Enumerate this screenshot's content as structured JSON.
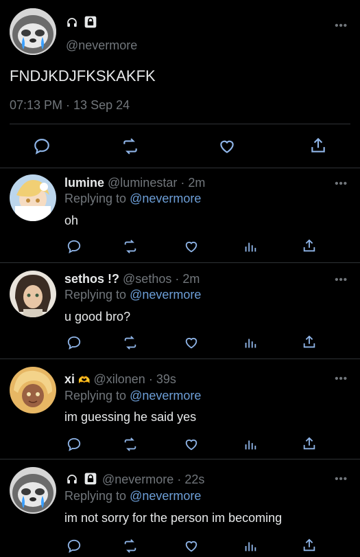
{
  "main_tweet": {
    "handle": "@nevermore",
    "text": "FNDJKDJFKSKAKFK",
    "timestamp": "07:13 PM · 13 Sep 24",
    "more_label": "•••",
    "icons": [
      "headphones-icon",
      "lock-icon"
    ]
  },
  "replies": [
    {
      "name": "lumine",
      "handle": "@luminestar",
      "time": "· 2m",
      "replying_prefix": "Replying to",
      "replying_to": "@nevermore",
      "text": "oh",
      "more_label": "•••"
    },
    {
      "name": "sethos !?",
      "handle": "@sethos",
      "time": "· 2m",
      "replying_prefix": "Replying to",
      "replying_to": "@nevermore",
      "text": "u good bro?",
      "more_label": "•••"
    },
    {
      "name": "xi",
      "name_emoji": "🫶",
      "handle": "@xilonen",
      "time": "· 39s",
      "replying_prefix": "Replying to",
      "replying_to": "@nevermore",
      "text": "im guessing he said yes",
      "more_label": "•••"
    },
    {
      "name": "",
      "handle": "@nevermore",
      "time": "· 22s",
      "replying_prefix": "Replying to",
      "replying_to": "@nevermore",
      "text": "im not sorry for the person im becoming",
      "more_label": "•••"
    }
  ],
  "colors": {
    "background": "#000000",
    "text": "#e7e9ea",
    "muted": "#71767b",
    "link": "#6d9fd8",
    "divider": "#2f3336"
  }
}
